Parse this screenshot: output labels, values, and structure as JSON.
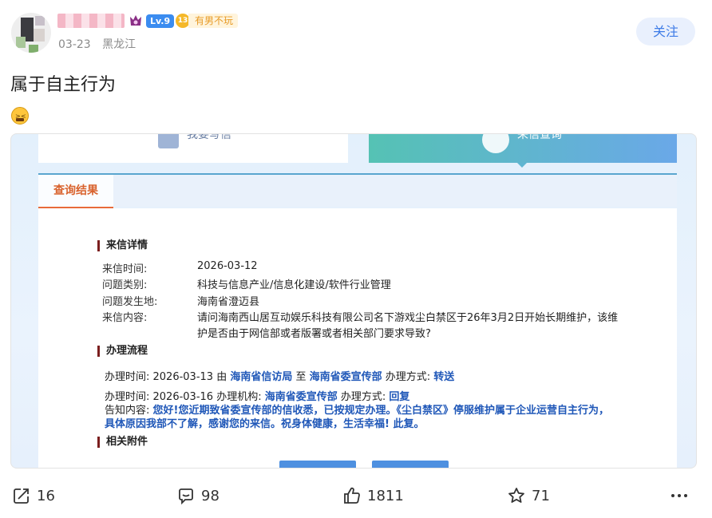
{
  "author": {
    "level": "Lv.9",
    "badge_number": "13",
    "badge_text": "有男不玩",
    "date": "03-23",
    "location": "黑龙江"
  },
  "follow_label": "关注",
  "post": {
    "text": "属于自主行为",
    "emoji": "angry-face-icon"
  },
  "screenshot": {
    "tab1_label": "我要写信",
    "tab2_label": "来信查询",
    "result_title": "查询结果",
    "details_title": "来信详情",
    "details": [
      {
        "label": "来信时间:",
        "value": "2026-03-12"
      },
      {
        "label": "问题类别:",
        "value": "科技与信息产业/信息化建设/软件行业管理"
      },
      {
        "label": "问题发生地:",
        "value": "海南省澄迈县"
      },
      {
        "label": "来信内容:",
        "value": "请问海南西山居互动娱乐科技有限公司名下游戏尘白禁区于26年3月2日开始长期维护，该维"
      },
      {
        "label": "",
        "value": "护是否由于网信部或者版署或者相关部门要求导致?"
      }
    ],
    "process_title": "办理流程",
    "process": {
      "row1_prefix": "办理时间:  2026-03-13 由 ",
      "row1_from": "海南省信访局",
      "row1_mid": " 至 ",
      "row1_to": "海南省委宣传部",
      "row1_method_label": " 办理方式:  ",
      "row1_method": "转送",
      "row2_prefix": "办理时间:  2026-03-16 办理机构:  ",
      "row2_org": "海南省委宣传部",
      "row2_method_label": " 办理方式:  ",
      "row2_method": "回复",
      "notice_label": "告知内容:  ",
      "notice_line1": "您好!您近期致省委宣传部的信收悉，已按规定办理。《尘白禁区》停服维护属于企业运营自主行为，",
      "notice_line2": "具体原因我部不了解，感谢您的来信。祝身体健康，生活幸福! 此复。"
    },
    "attachments_title": "相关附件"
  },
  "actions": {
    "share": "16",
    "comment": "98",
    "like": "1811",
    "favorite": "71"
  },
  "colors": {
    "accent_blue": "#3e7ce7",
    "link_blue": "#1f57b8",
    "result_orange": "#d9632e"
  }
}
